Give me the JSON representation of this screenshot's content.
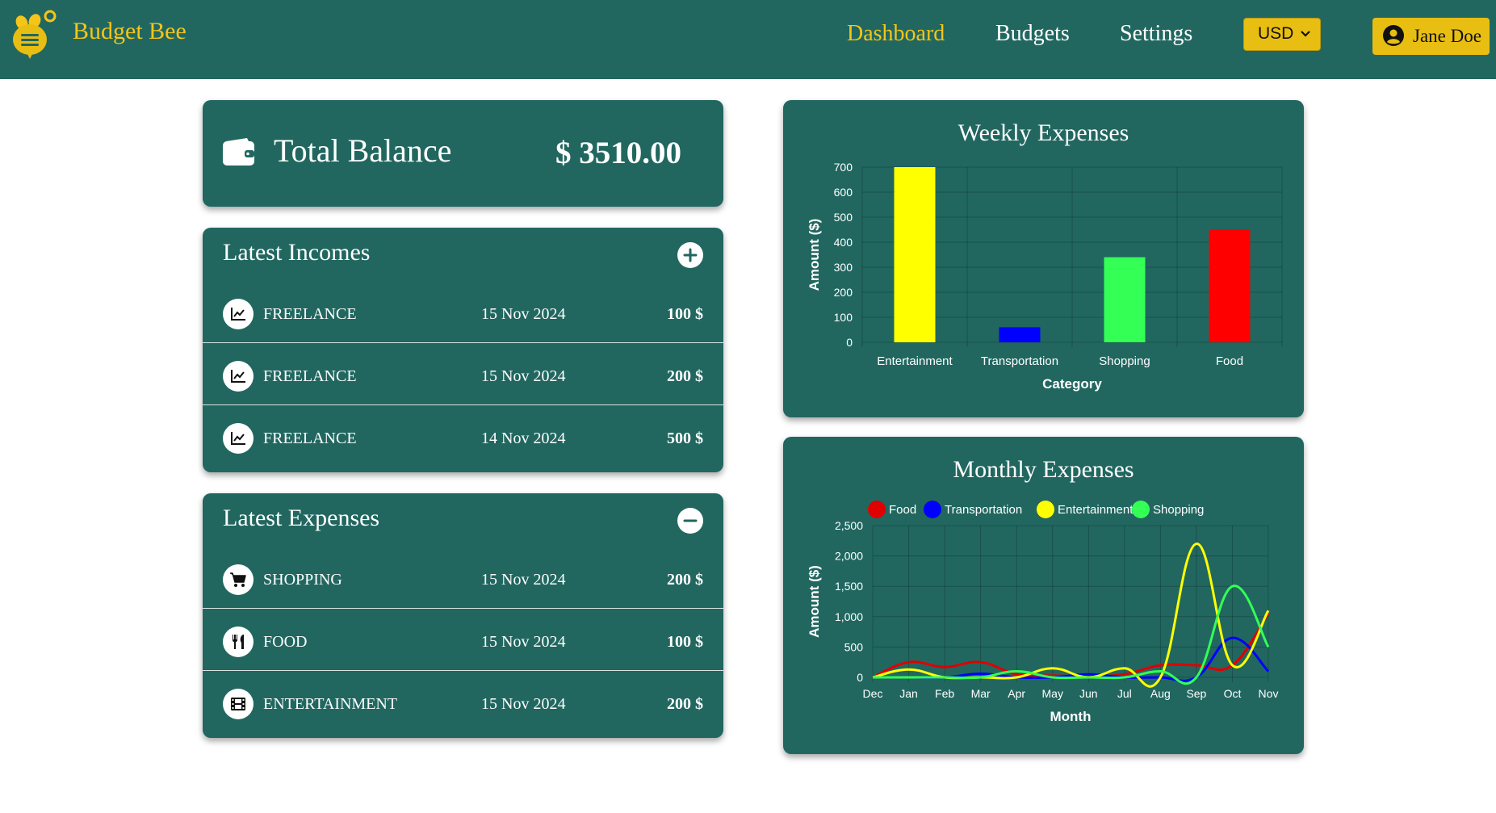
{
  "brand": {
    "name": "Budget Bee"
  },
  "nav": {
    "dashboard": "Dashboard",
    "budgets": "Budgets",
    "settings": "Settings"
  },
  "currency": {
    "selected": "USD"
  },
  "user": {
    "name": "Jane Doe"
  },
  "balance": {
    "label": "Total Balance",
    "amount": "$ 3510.00"
  },
  "incomes": {
    "title": "Latest Incomes",
    "items": [
      {
        "name": "FREELANCE",
        "date": "15 Nov 2024",
        "amount": "100 $",
        "icon": "chart-line-icon"
      },
      {
        "name": "FREELANCE",
        "date": "15 Nov 2024",
        "amount": "200 $",
        "icon": "chart-line-icon"
      },
      {
        "name": "FREELANCE",
        "date": "14 Nov 2024",
        "amount": "500 $",
        "icon": "chart-line-icon"
      }
    ]
  },
  "expenses": {
    "title": "Latest Expenses",
    "items": [
      {
        "name": "SHOPPING",
        "date": "15 Nov 2024",
        "amount": "200 $",
        "icon": "cart-icon"
      },
      {
        "name": "FOOD",
        "date": "15 Nov 2024",
        "amount": "100 $",
        "icon": "utensils-icon"
      },
      {
        "name": "ENTERTAINMENT",
        "date": "15 Nov 2024",
        "amount": "200 $",
        "icon": "film-icon"
      }
    ]
  },
  "colors": {
    "primary": "#216760",
    "accent": "#f5c518",
    "button": "#e8be12"
  },
  "chart_data": [
    {
      "type": "bar",
      "title": "Weekly Expenses",
      "xlabel": "Category",
      "ylabel": "Amount ($)",
      "categories": [
        "Entertainment",
        "Transportation",
        "Shopping",
        "Food"
      ],
      "values": [
        700,
        60,
        340,
        450
      ],
      "colors": [
        "#ffff00",
        "#0000ff",
        "#33ff55",
        "#ff0000"
      ],
      "ylim": [
        0,
        700
      ],
      "yticks": [
        "0",
        "100",
        "200",
        "300",
        "400",
        "500",
        "600",
        "700"
      ],
      "grid": true
    },
    {
      "type": "line",
      "title": "Monthly Expenses",
      "xlabel": "Month",
      "ylabel": "Amount ($)",
      "categories": [
        "Dec",
        "Jan",
        "Feb",
        "Mar",
        "Apr",
        "May",
        "Jun",
        "Jul",
        "Aug",
        "Sep",
        "Oct",
        "Nov"
      ],
      "ylim": [
        0,
        2500
      ],
      "yticks": [
        "0",
        "500",
        "1,000",
        "1,500",
        "2,000",
        "2,500"
      ],
      "legend_position": "top",
      "grid": true,
      "series": [
        {
          "name": "Food",
          "color": "#e00000",
          "values": [
            0,
            250,
            170,
            250,
            50,
            30,
            20,
            50,
            200,
            200,
            200,
            1050
          ]
        },
        {
          "name": "Transportation",
          "color": "#0000ff",
          "values": [
            0,
            0,
            0,
            60,
            0,
            0,
            50,
            0,
            0,
            0,
            650,
            100
          ]
        },
        {
          "name": "Entertainment",
          "color": "#ffff00",
          "values": [
            0,
            130,
            0,
            0,
            0,
            150,
            0,
            150,
            0,
            2200,
            200,
            1100
          ]
        },
        {
          "name": "Shopping",
          "color": "#33ff55",
          "values": [
            0,
            0,
            0,
            0,
            100,
            0,
            0,
            0,
            100,
            0,
            1500,
            500
          ]
        }
      ]
    }
  ]
}
